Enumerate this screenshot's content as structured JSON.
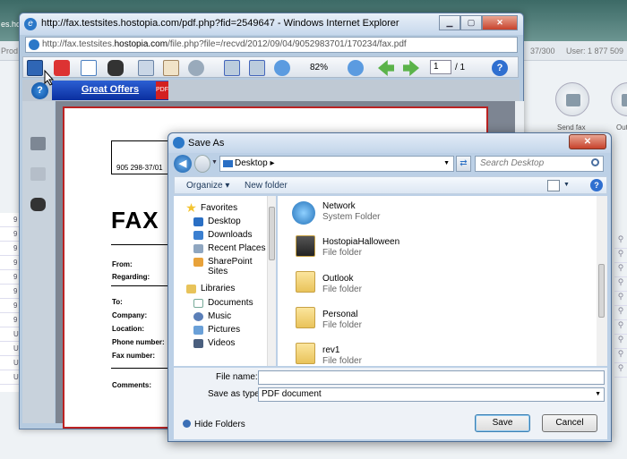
{
  "background": {
    "tab_fragment": "es.ho",
    "nav_fragment": "Prod",
    "counter": "37/300",
    "user_label": "User: 1 877 509",
    "send_fax_label": "Send fax",
    "out_label": "Out",
    "list_items": [
      "9",
      "9",
      "9",
      "9",
      "9",
      "9",
      "9",
      "9",
      "U",
      "U",
      "U",
      "U"
    ]
  },
  "ie_window": {
    "title": "http://fax.testsites.hostopia.com/pdf.php?fid=2549647 - Windows Internet Explorer",
    "address_prefix": "http://fax.testsites.",
    "address_domain": "hostopia.com",
    "address_suffix": "/file.php?file=/recvd/2012/09/04/9052983701/170234/fax.pdf",
    "zoom_level": "82%",
    "page_current": "1",
    "page_total": "/ 1",
    "ad_label": "Great Offers"
  },
  "fax_document": {
    "fax_number": "905 298-37/01",
    "title": "FAX",
    "fields": [
      "From:",
      "Regarding:",
      "To:",
      "Company:",
      "Location:",
      "Phone number:",
      "Fax number:",
      "Comments:"
    ]
  },
  "save_dialog": {
    "title": "Save As",
    "location": "Desktop",
    "search_placeholder": "Search Desktop",
    "organize_label": "Organize ▾",
    "new_folder_label": "New folder",
    "nav_favorites": "Favorites",
    "nav_favorite_items": [
      "Desktop",
      "Downloads",
      "Recent Places",
      "SharePoint Sites"
    ],
    "nav_libraries": "Libraries",
    "nav_library_items": [
      "Documents",
      "Music",
      "Pictures",
      "Videos"
    ],
    "files": [
      {
        "name": "Network",
        "type": "System Folder"
      },
      {
        "name": "HostopiaHalloween",
        "type": "File folder"
      },
      {
        "name": "Outlook",
        "type": "File folder"
      },
      {
        "name": "Personal",
        "type": "File folder"
      },
      {
        "name": "rev1",
        "type": "File folder"
      }
    ],
    "file_name_label": "File name:",
    "file_name_value": "",
    "save_type_label": "Save as type:",
    "save_type_value": "PDF document",
    "hide_folders_label": "Hide Folders",
    "save_label": "Save",
    "cancel_label": "Cancel"
  },
  "colors": {
    "accent": "#2b78c8",
    "close_red": "#c7422c",
    "doc_border": "#b22222"
  }
}
